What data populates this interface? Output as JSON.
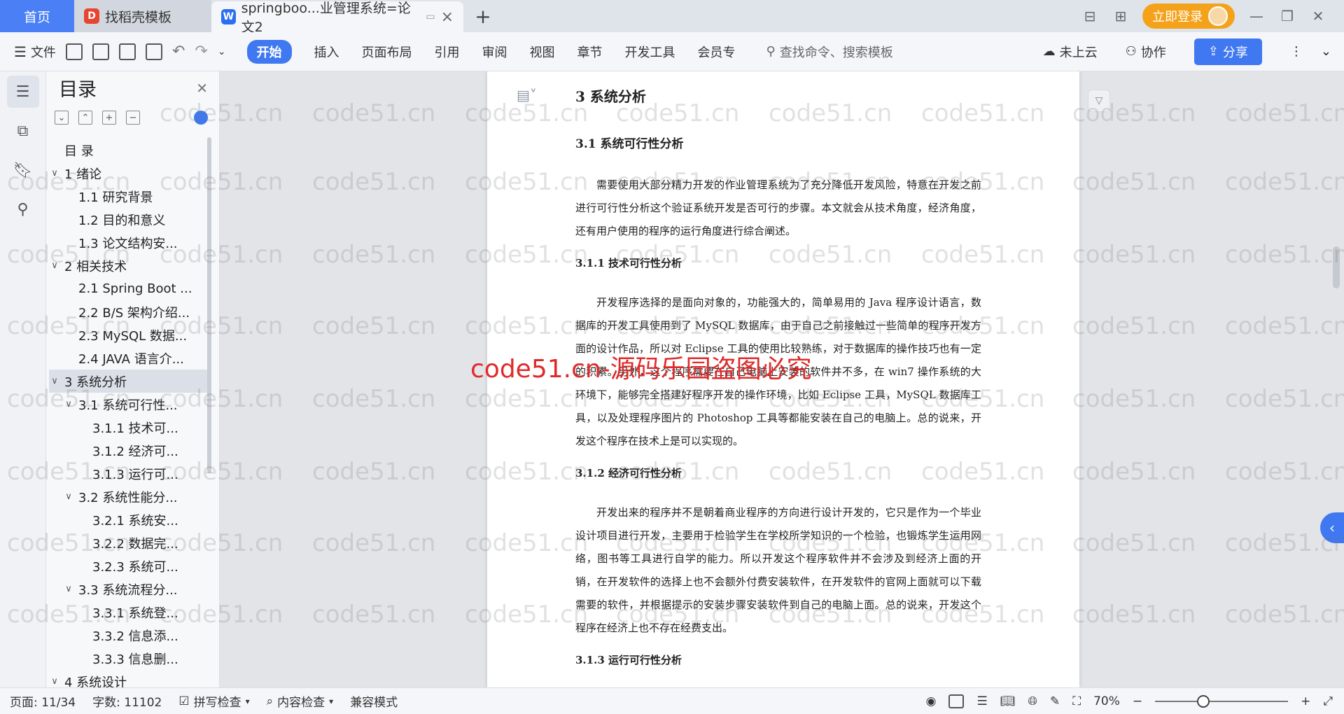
{
  "tabs": {
    "home": "首页",
    "template": "找稻壳模板",
    "document": "springboo...业管理系统=论文2"
  },
  "titlebar": {
    "login": "立即登录"
  },
  "ribbon": {
    "file": "文件",
    "menus": [
      "开始",
      "插入",
      "页面布局",
      "引用",
      "审阅",
      "视图",
      "章节",
      "开发工具",
      "会员专"
    ],
    "search_placeholder": "查找命令、搜索模板",
    "cloud": "未上云",
    "collab": "协作",
    "share": "分享"
  },
  "toc": {
    "title": "目录",
    "items": [
      {
        "label": "目  录",
        "level": 1,
        "caret": ""
      },
      {
        "label": "1  绪论",
        "level": 1,
        "caret": "v"
      },
      {
        "label": "1.1  研究背景",
        "level": 2,
        "caret": ""
      },
      {
        "label": "1.2 目的和意义",
        "level": 2,
        "caret": ""
      },
      {
        "label": "1.3  论文结构安...",
        "level": 2,
        "caret": ""
      },
      {
        "label": "2  相关技术",
        "level": 1,
        "caret": "v"
      },
      {
        "label": "2.1 Spring Boot ...",
        "level": 2,
        "caret": ""
      },
      {
        "label": "2.2 B/S 架构介绍...",
        "level": 2,
        "caret": ""
      },
      {
        "label": "2.3 MySQL 数据...",
        "level": 2,
        "caret": ""
      },
      {
        "label": "2.4 JAVA 语言介...",
        "level": 2,
        "caret": ""
      },
      {
        "label": "3  系统分析",
        "level": 1,
        "caret": "v",
        "active": true
      },
      {
        "label": "3.1 系统可行性...",
        "level": 2,
        "caret": "v"
      },
      {
        "label": "3.1.1  技术可...",
        "level": 3,
        "caret": ""
      },
      {
        "label": "3.1.2  经济可...",
        "level": 3,
        "caret": ""
      },
      {
        "label": "3.1.3  运行可...",
        "level": 3,
        "caret": ""
      },
      {
        "label": "3.2 系统性能分...",
        "level": 2,
        "caret": "v"
      },
      {
        "label": "3.2.1  系统安...",
        "level": 3,
        "caret": ""
      },
      {
        "label": "3.2.2  数据完...",
        "level": 3,
        "caret": ""
      },
      {
        "label": "3.2.3 系统可...",
        "level": 3,
        "caret": ""
      },
      {
        "label": "3.3 系统流程分...",
        "level": 2,
        "caret": "v"
      },
      {
        "label": "3.3.1 系统登...",
        "level": 3,
        "caret": ""
      },
      {
        "label": "3.3.2 信息添...",
        "level": 3,
        "caret": ""
      },
      {
        "label": "3.3.3 信息删...",
        "level": 3,
        "caret": ""
      },
      {
        "label": "4  系统设计",
        "level": 1,
        "caret": "v"
      }
    ]
  },
  "document": {
    "chapter": "3  系统分析",
    "sec1": "3.1 系统可行性分析",
    "para1": "需要使用大部分精力开发的作业管理系统为了充分降低开发风险，特意在开发之前进行可行性分析这个验证系统开发是否可行的步骤。本文就会从技术角度，经济角度，还有用户使用的程序的运行角度进行综合阐述。",
    "sub1": "3.1.1  技术可行性分析",
    "para2": "开发程序选择的是面向对象的，功能强大的，简单易用的 Java 程序设计语言，数据库的开发工具使用到了 MySQL 数据库，由于自己之前接触过一些简单的程序开发方面的设计作品，所以对 Eclipse 工具的使用比较熟练，对于数据库的操作技巧也有一定的积累。另外，这个程序需要在自己电脑上安装的软件并不多，在 win7 操作系统的大环境下，能够完全搭建好程序开发的操作环境，比如 Eclipse 工具，MySQL 数据库工具，以及处理程序图片的 Photoshop 工具等都能安装在自己的电脑上。总的说来，开发这个程序在技术上是可以实现的。",
    "sub2": "3.1.2  经济可行性分析",
    "para3": "开发出来的程序并不是朝着商业程序的方向进行设计开发的，它只是作为一个毕业设计项目进行开发，主要用于检验学生在学校所学知识的一个检验，也锻炼学生运用网络，图书等工具进行自学的能力。所以开发这个程序软件并不会涉及到经济上面的开销，在开发软件的选择上也不会额外付费安装软件，在开发软件的官网上面就可以下载需要的软件，并根据提示的安装步骤安装软件到自己的电脑上面。总的说来，开发这个程序在经济上也不存在经费支出。",
    "sub3": "3.1.3  运行可行性分析"
  },
  "watermark": {
    "text": "code51.cn",
    "red": "code51.cn-源码乐园盗图必究"
  },
  "status": {
    "page": "页面: 11/34",
    "words": "字数: 11102",
    "spell": "拼写检查",
    "content": "内容检查",
    "compat": "兼容模式",
    "zoom": "70%"
  },
  "colors": {
    "accent": "#3f78f0",
    "login": "#f5a21b",
    "watermark_red": "#e02a2a"
  }
}
